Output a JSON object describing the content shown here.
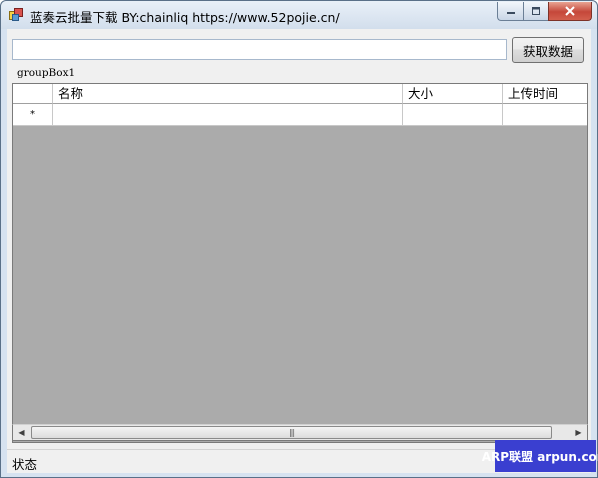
{
  "window": {
    "title": "蓝奏云批量下载 BY:chainliq https://www.52pojie.cn/",
    "icon": "app-window-icon"
  },
  "toolbar": {
    "url_input_value": "",
    "fetch_label": "获取数据"
  },
  "group": {
    "label": "groupBox1"
  },
  "grid": {
    "columns": [
      "名称",
      "大小",
      "上传时间"
    ],
    "new_row_marker": "*"
  },
  "scrollbar": {
    "left_arrow": "◀",
    "right_arrow": "▶",
    "thumb_grip": "|||"
  },
  "status": {
    "text": "状态"
  },
  "watermark": {
    "text": "ARP联盟 arpun.com"
  },
  "colors": {
    "grid_background": "#ababab",
    "close_button": "#c5473a",
    "watermark_bg": "#3a3fd0"
  }
}
